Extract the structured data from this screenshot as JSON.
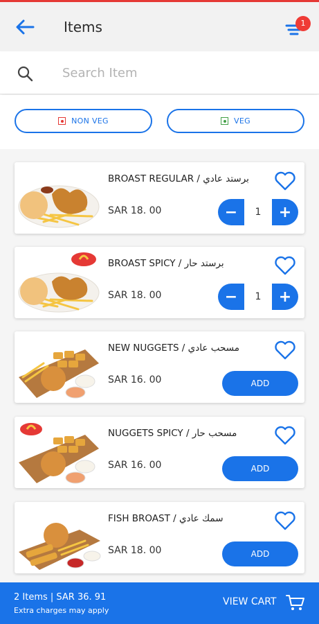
{
  "header": {
    "title": "Items",
    "filter_badge": "1"
  },
  "search": {
    "placeholder": "Search Item"
  },
  "filters": {
    "nonveg_label": "NON VEG",
    "veg_label": "VEG"
  },
  "colors": {
    "accent": "#1a73e8",
    "badge": "#ef3b36",
    "nonveg": "#e53935",
    "veg": "#43a047"
  },
  "items": [
    {
      "name": "BROAST REGULAR / برستد عادي",
      "price": "SAR 18. 00",
      "qty": "1",
      "action": "stepper",
      "image": "broast-plate"
    },
    {
      "name": "BROAST SPICY / برستد حار",
      "price": "SAR 18. 00",
      "qty": "1",
      "action": "stepper",
      "image": "broast-spicy-plate"
    },
    {
      "name": "NEW NUGGETS / مسحب عادي",
      "price": "SAR 16. 00",
      "add_label": "ADD",
      "action": "add",
      "image": "nuggets-board"
    },
    {
      "name": "NUGGETS SPICY / مسحب حار",
      "price": "SAR 16. 00",
      "add_label": "ADD",
      "action": "add",
      "image": "nuggets-spicy-board"
    },
    {
      "name": "FISH BROAST / سمك عادي",
      "price": "SAR 18. 00",
      "add_label": "ADD",
      "action": "add",
      "image": "fish-board"
    }
  ],
  "stepper": {
    "minus": "−",
    "plus": "+"
  },
  "cart": {
    "summary": "2 Items | SAR 36. 91",
    "note": "Extra charges may apply",
    "view_label": "VIEW CART"
  }
}
